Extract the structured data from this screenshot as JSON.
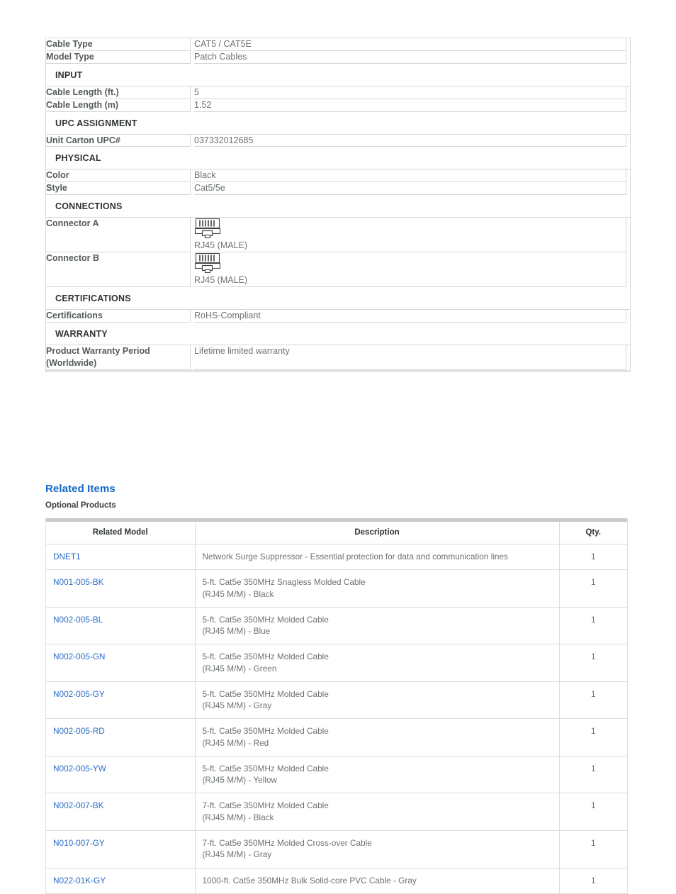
{
  "specs": {
    "rows": [
      {
        "kind": "row",
        "label": "Cable Type",
        "value": "CAT5 / CAT5E"
      },
      {
        "kind": "row",
        "label": "Model Type",
        "value": "Patch Cables"
      },
      {
        "kind": "section",
        "label": "INPUT"
      },
      {
        "kind": "row",
        "label": "Cable Length (ft.)",
        "value": "5"
      },
      {
        "kind": "row",
        "label": "Cable Length (m)",
        "value": "1.52"
      },
      {
        "kind": "section",
        "label": "UPC ASSIGNMENT"
      },
      {
        "kind": "row",
        "label": "Unit Carton UPC#",
        "value": "037332012685"
      },
      {
        "kind": "section",
        "label": "PHYSICAL"
      },
      {
        "kind": "row",
        "label": "Color",
        "value": "Black"
      },
      {
        "kind": "row",
        "label": "Style",
        "value": "Cat5/5e"
      },
      {
        "kind": "section",
        "label": "CONNECTIONS"
      },
      {
        "kind": "connector",
        "label": "Connector A",
        "value": "RJ45 (MALE)",
        "icon": "rj45-connector-icon"
      },
      {
        "kind": "connector",
        "label": "Connector B",
        "value": "RJ45 (MALE)",
        "icon": "rj45-connector-icon"
      },
      {
        "kind": "section",
        "label": "CERTIFICATIONS"
      },
      {
        "kind": "row",
        "label": "Certifications",
        "value": "RoHS-Compliant"
      },
      {
        "kind": "section",
        "label": "WARRANTY"
      },
      {
        "kind": "row",
        "label": "Product Warranty Period (Worldwide)",
        "label_line1": "Product Warranty Period",
        "label_line2": "(Worldwide)",
        "value": "Lifetime limited warranty"
      }
    ]
  },
  "related": {
    "heading": "Related Items",
    "subheading": "Optional Products",
    "columns": [
      "Related Model",
      "Description",
      "Qty."
    ],
    "rows": [
      {
        "model": "DNET1",
        "desc1": "Network Surge Suppressor - Essential protection for data and communication lines",
        "desc2": "",
        "qty": "1"
      },
      {
        "model": "N001-005-BK",
        "desc1": "5-ft. Cat5e 350MHz Snagless Molded Cable",
        "desc2": "(RJ45 M/M) - Black",
        "qty": "1"
      },
      {
        "model": "N002-005-BL",
        "desc1": "5-ft. Cat5e 350MHz Molded Cable",
        "desc2": "(RJ45 M/M) - Blue",
        "qty": "1"
      },
      {
        "model": "N002-005-GN",
        "desc1": "5-ft. Cat5e 350MHz Molded Cable",
        "desc2": "(RJ45 M/M) - Green",
        "qty": "1"
      },
      {
        "model": "N002-005-GY",
        "desc1": "5-ft. Cat5e 350MHz Molded Cable",
        "desc2": "(RJ45 M/M) - Gray",
        "qty": "1"
      },
      {
        "model": "N002-005-RD",
        "desc1": "5-ft. Cat5e 350MHz Molded Cable",
        "desc2": "(RJ45 M/M) - Red",
        "qty": "1"
      },
      {
        "model": "N002-005-YW",
        "desc1": "5-ft. Cat5e 350MHz Molded Cable",
        "desc2": "(RJ45 M/M) - Yellow",
        "qty": "1"
      },
      {
        "model": "N002-007-BK",
        "desc1": "7-ft. Cat5e 350MHz Molded Cable",
        "desc2": "(RJ45 M/M) - Black",
        "qty": "1"
      },
      {
        "model": "N010-007-GY",
        "desc1": "7-ft. Cat5e 350MHz Molded Cross-over Cable",
        "desc2": "(RJ45 M/M) - Gray",
        "qty": "1"
      },
      {
        "model": "N022-01K-GY",
        "desc1": "1000-ft. Cat5e 350MHz Bulk Solid-core PVC Cable - Gray",
        "desc2": "",
        "qty": "1"
      }
    ]
  },
  "colors": {
    "heading_blue": "#1569c7",
    "link_blue": "#2b6cc4",
    "label_text": "#555b5e",
    "value_text": "#6c7276",
    "section_text": "#2f3336",
    "border": "#d6d6d6"
  }
}
